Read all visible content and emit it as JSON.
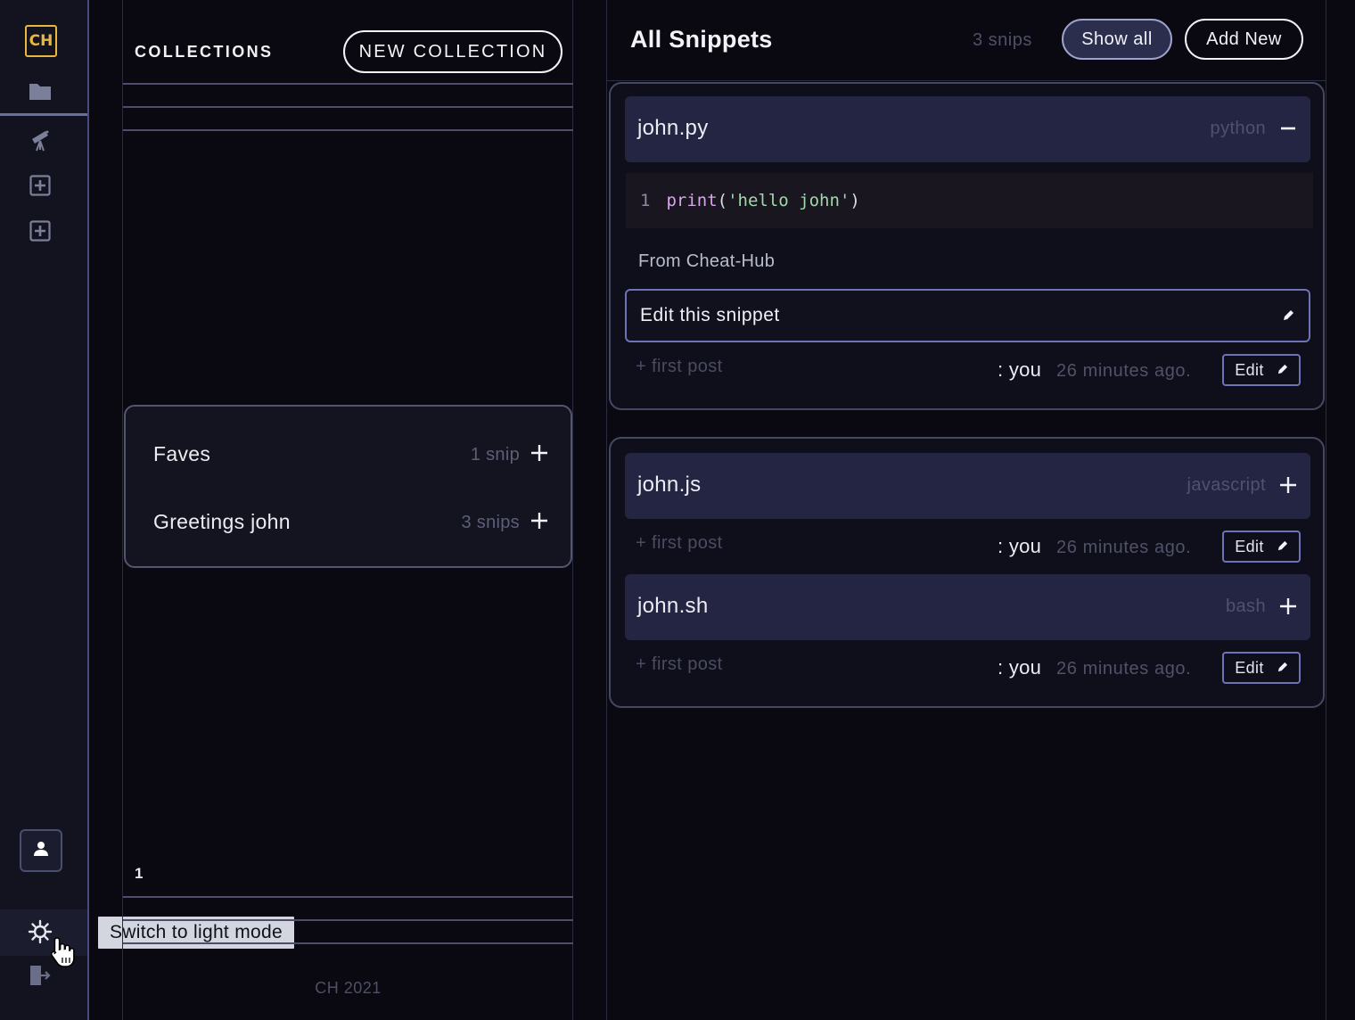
{
  "app": {
    "logo_text": "CH",
    "footer": "CH 2021"
  },
  "sidebar": {
    "items": [
      {
        "icon": "folder-icon"
      },
      {
        "icon": "telescope-icon"
      },
      {
        "icon": "plus-square-icon"
      },
      {
        "icon": "plus-square-icon"
      }
    ],
    "user_icon": "user-icon",
    "theme_icon": "sun-icon",
    "logout_icon": "logout-icon",
    "tooltip": "Switch to light mode"
  },
  "collections": {
    "title": "COLLECTIONS",
    "new_button": "NEW COLLECTION",
    "items": [
      {
        "name": "Faves",
        "count": "1 snip"
      },
      {
        "name": "Greetings john",
        "count": "3 snips"
      }
    ],
    "page": "1"
  },
  "snippets": {
    "title": "All Snippets",
    "count": "3 snips",
    "show_all": "Show all",
    "add_new": "Add New",
    "expanded": {
      "name": "john.py",
      "language": "python",
      "code_line_no": "1",
      "code_fn": "print",
      "code_open": "(",
      "code_str": "'hello john'",
      "code_close": ")",
      "description": "From Cheat-Hub",
      "edit_label": "Edit this snippet",
      "tag": "+ first post",
      "author": ": you",
      "time": "26 minutes ago.",
      "edit_btn": "Edit"
    },
    "collapsed": [
      {
        "name": "john.js",
        "language": "javascript",
        "tag": "+ first post",
        "author": ": you",
        "time": "26 minutes ago.",
        "edit_btn": "Edit"
      },
      {
        "name": "john.sh",
        "language": "bash",
        "tag": "+ first post",
        "author": ": you",
        "time": "26 minutes ago.",
        "edit_btn": "Edit"
      }
    ]
  },
  "colors": {
    "accent": "#e9b73d",
    "border": "#6d73b4",
    "background": "#0a0911",
    "card_header": "#232542"
  }
}
